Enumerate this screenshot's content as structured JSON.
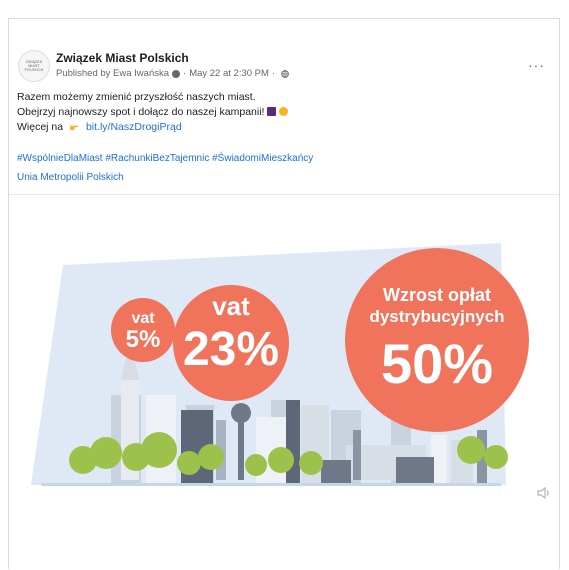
{
  "post": {
    "page_name": "Związek Miast Polskich",
    "avatar_text_1": "ZWIĄZEK",
    "avatar_text_2": "MIAST",
    "avatar_text_3": "POLSKICH",
    "published_by": "Published by Ewa Iwańska",
    "date": "May 22 at 2:30 PM",
    "more_label": "···",
    "line1": "Razem możemy zmienić przyszłość naszych miast.",
    "line2": "Obejrzyj najnowszy spot i dołącz do naszej kampanii!",
    "line3_prefix": "Więcej na",
    "link_text": "bit.ly/NaszDrogiPrąd",
    "hashtags": [
      "#WspólnieDlaMiast",
      "#RachunkiBezTajemnic",
      "#ŚwiadomiMieszkańcy"
    ],
    "mention": "Unia Metropolii Polskich"
  },
  "media": {
    "bubble_small_label": "vat",
    "bubble_small_value": "5%",
    "bubble_mid_label": "vat",
    "bubble_mid_value": "23%",
    "bubble_big_line1": "Wzrost opłat",
    "bubble_big_line2": "dystrybucyjnych",
    "bubble_big_value": "50%"
  },
  "colors": {
    "link": "#216fdb",
    "bubble": "#f0735c",
    "sky": "#dfe9f6",
    "tree": "#9cc24b"
  }
}
